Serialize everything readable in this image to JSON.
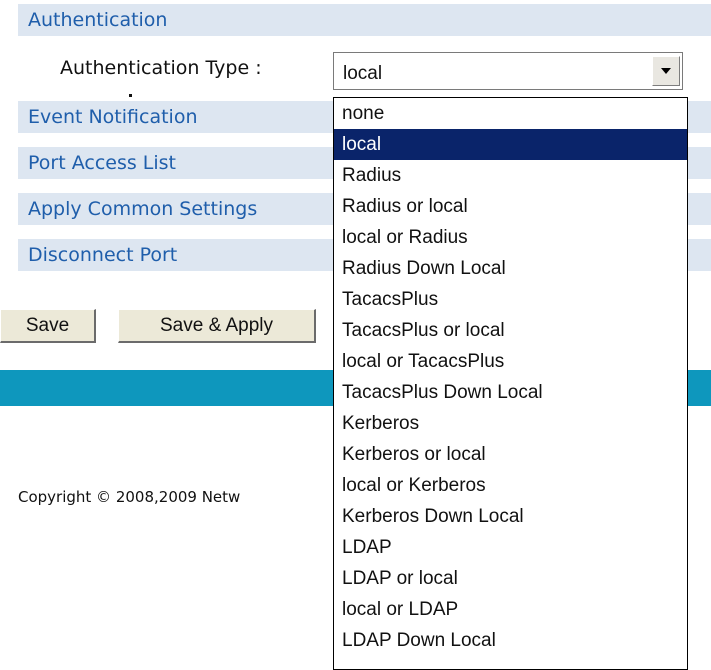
{
  "sections": {
    "authentication": "Authentication",
    "event_notification": "Event Notification",
    "port_access_list": "Port Access List",
    "apply_common_settings": "Apply Common Settings",
    "disconnect_port": "Disconnect Port"
  },
  "auth_type": {
    "label": "Authentication Type :",
    "selected_value": "local",
    "options": [
      "none",
      "local",
      "Radius",
      "Radius or local",
      "local or Radius",
      "Radius Down Local",
      "TacacsPlus",
      "TacacsPlus or local",
      "local or TacacsPlus",
      "TacacsPlus Down Local",
      "Kerberos",
      "Kerberos or local",
      "local or Kerberos",
      "Kerberos Down Local",
      "LDAP",
      "LDAP or local",
      "local or LDAP",
      "LDAP Down Local"
    ],
    "highlighted_index": 1
  },
  "buttons": {
    "save": "Save",
    "save_apply": "Save & Apply"
  },
  "footer": {
    "copyright": "Copyright © 2008,2009 Netw"
  },
  "colors": {
    "section_bar_bg": "#dde6f1",
    "section_text": "#1f5eab",
    "highlight_bg": "#0a246a",
    "band": "#0e97bd"
  },
  "icons": {
    "dropdown_arrow": "chevron-down-icon"
  }
}
